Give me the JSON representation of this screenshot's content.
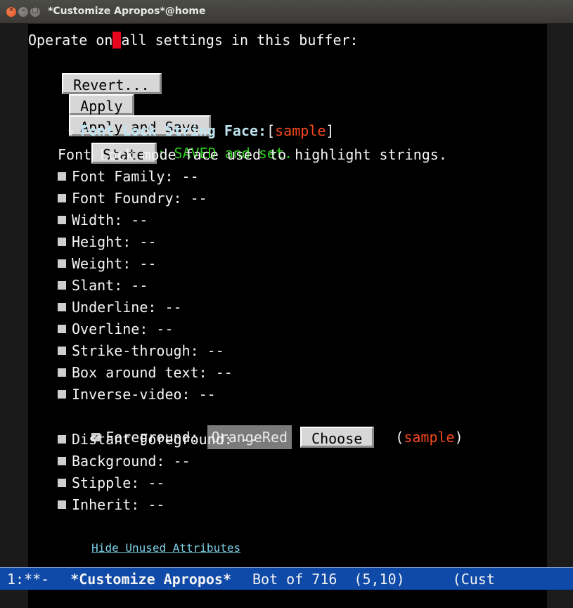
{
  "window": {
    "title": "*Customize Apropos*@home"
  },
  "buffer": {
    "operate_text_before": "Operate on",
    "operate_text_after": "all settings in this buffer:",
    "buttons": {
      "revert": "Revert...",
      "apply": "Apply",
      "apply_save": "Apply and Save"
    },
    "face": {
      "name": "Font Lock String Face:",
      "bracket_open": "[",
      "sample": "sample",
      "bracket_close": "]",
      "state_button": "State",
      "state_text": ": SAVED and set.",
      "doc": "Font Lock mode face used to highlight strings.",
      "attributes": [
        "Font Family: --",
        "Font Foundry: --",
        "Width: --",
        "Height: --",
        "Weight: --",
        "Slant: --",
        "Underline: --",
        "Overline: --",
        "Strike-through: --",
        "Box around text: --",
        "Inverse-video: --"
      ],
      "foreground": {
        "label": "Foreground: ",
        "value": "OrangeRed",
        "choose": "Choose",
        "sample_open": "(",
        "sample": "sample",
        "sample_close": ")",
        "checked": true
      },
      "attributes_after": [
        "Distant Foreground: --",
        "Background: --",
        "Stipple: --",
        "Inherit: --"
      ],
      "hide_link": "Hide Unused Attributes"
    }
  },
  "modeline": {
    "status": "1:**-",
    "buffer_name": "*Customize Apropos*",
    "position": "Bot of 716",
    "coords": "(5,10)",
    "mode": "(Cust"
  },
  "colors": {
    "face_sample": "#f2481d",
    "saved": "#2fcf1f",
    "link": "#7ed0e8",
    "modeline_bg": "#0f4aa8"
  }
}
